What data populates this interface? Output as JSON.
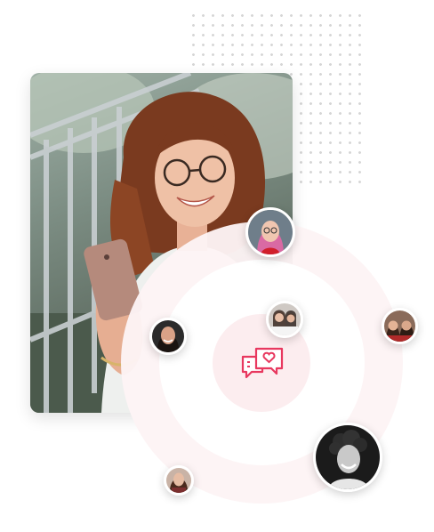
{
  "colors": {
    "accent": "#e8385f",
    "ring_outer": "#fdf4f5",
    "ring_inner": "#fcedef",
    "dot_grid": "#d6d6d6"
  },
  "hero": {
    "image": "woman-with-glasses-smiling-at-phone"
  },
  "center_icon": "chat-bubbles-heart-icon",
  "avatars": [
    {
      "name": "avatar-pink-hair-woman"
    },
    {
      "name": "avatar-two-women-small"
    },
    {
      "name": "avatar-dark-hair-woman"
    },
    {
      "name": "avatar-two-women-right"
    },
    {
      "name": "avatar-curly-hair-man"
    },
    {
      "name": "avatar-woman-bottom"
    }
  ]
}
